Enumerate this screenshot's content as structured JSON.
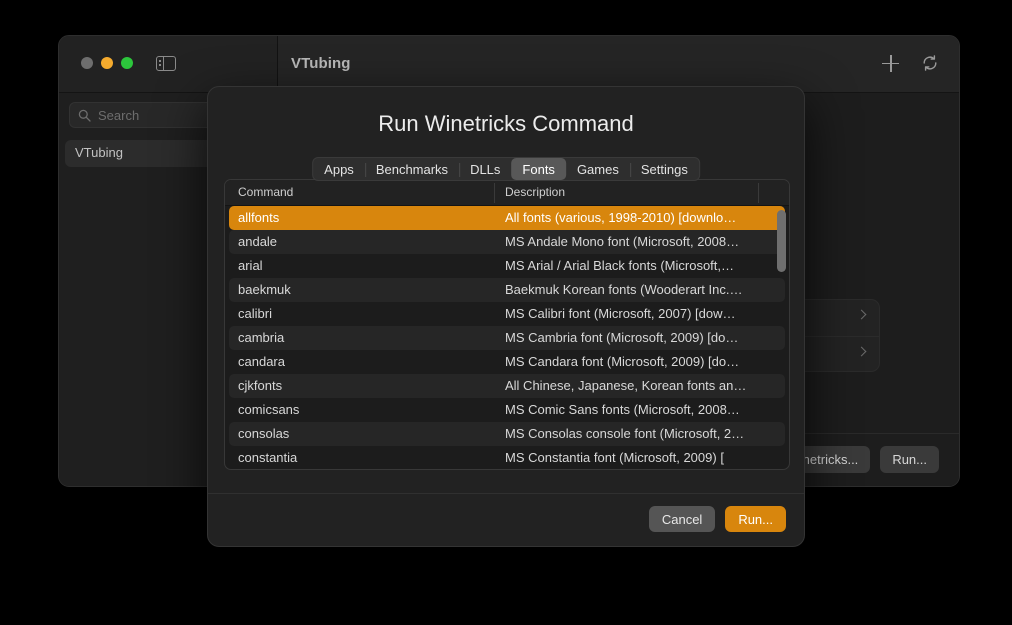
{
  "background_window": {
    "title": "VTubing",
    "traffic_lights": [
      "close-button",
      "minimize-button",
      "maximize-button"
    ],
    "sidebar_toggle_icon": "sidebar-toggle-icon",
    "titlebar_actions": [
      {
        "icon": "plus-icon",
        "label": ""
      },
      {
        "icon": "refresh-icon",
        "label": ""
      }
    ],
    "search": {
      "placeholder": "Search",
      "value": "",
      "icon": "search-icon"
    },
    "sidebar_items": [
      {
        "label": "VTubing"
      }
    ],
    "detail_rows": [
      {
        "label": "",
        "chevron": "chevron-right-icon"
      },
      {
        "label": "",
        "chevron": "chevron-right-icon"
      }
    ],
    "footer_buttons": [
      {
        "label": "Winetricks..."
      },
      {
        "label": "Run..."
      }
    ]
  },
  "dialog": {
    "title": "Run Winetricks Command",
    "tabs": [
      {
        "label": "Apps",
        "selected": false
      },
      {
        "label": "Benchmarks",
        "selected": false
      },
      {
        "label": "DLLs",
        "selected": false
      },
      {
        "label": "Fonts",
        "selected": true
      },
      {
        "label": "Games",
        "selected": false
      },
      {
        "label": "Settings",
        "selected": false
      }
    ],
    "table": {
      "columns": [
        "Command",
        "Description"
      ],
      "rows": [
        {
          "command": "allfonts",
          "description": "All fonts (various, 1998-2010) [downlo…",
          "selected": true
        },
        {
          "command": "andale",
          "description": "MS Andale Mono font (Microsoft, 2008…",
          "selected": false
        },
        {
          "command": "arial",
          "description": "MS Arial / Arial Black fonts (Microsoft,…",
          "selected": false
        },
        {
          "command": "baekmuk",
          "description": "Baekmuk Korean fonts (Wooderart Inc.…",
          "selected": false
        },
        {
          "command": "calibri",
          "description": "MS Calibri font (Microsoft, 2007) [dow…",
          "selected": false
        },
        {
          "command": "cambria",
          "description": "MS Cambria font (Microsoft, 2009) [do…",
          "selected": false
        },
        {
          "command": "candara",
          "description": "MS Candara font (Microsoft, 2009) [do…",
          "selected": false
        },
        {
          "command": "cjkfonts",
          "description": "All Chinese, Japanese, Korean fonts an…",
          "selected": false
        },
        {
          "command": "comicsans",
          "description": "MS Comic Sans fonts (Microsoft, 2008…",
          "selected": false
        },
        {
          "command": "consolas",
          "description": "MS Consolas console font (Microsoft, 2…",
          "selected": false
        },
        {
          "command": "constantia",
          "description": "MS Constantia font (Microsoft, 2009) [",
          "selected": false
        }
      ]
    },
    "scrollbar": {
      "name": "list-scrollbar",
      "thumb_position_percent": 2
    },
    "buttons": {
      "cancel": "Cancel",
      "run": "Run..."
    }
  },
  "colors": {
    "accent_orange": "#d8860d",
    "window_bg": "#1e1e1e",
    "dialog_bg": "#222222",
    "list_bg": "#1c1c1c",
    "row_alt": "#262626"
  }
}
